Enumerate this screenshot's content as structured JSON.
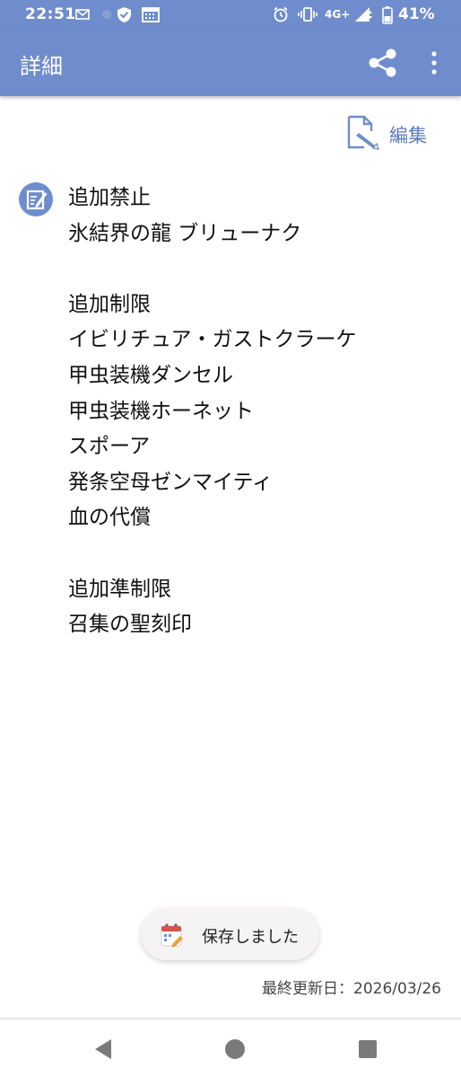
{
  "status_bar": {
    "time": "22:51",
    "network": "4G+",
    "battery": "41%",
    "icons": [
      "mail-icon",
      "vpn-shield-icon",
      "calendar-icon",
      "alarm-icon",
      "vibrate-icon",
      "signal-icon",
      "battery-icon"
    ]
  },
  "app_bar": {
    "title": "詳細",
    "icons": [
      "share-icon",
      "more-vert-icon"
    ],
    "color": "#6f8ccc"
  },
  "edit": {
    "label": "編集",
    "icon": "edit-document-icon",
    "color": "#5b79be"
  },
  "note": {
    "icon": "note-edit-icon",
    "lines": [
      "追加禁止",
      "氷結界の龍 ブリューナク",
      "",
      "追加制限",
      "イビリチュア・ガストクラーケ",
      "甲虫装機ダンセル",
      "甲虫装機ホーネット",
      "スポーア",
      "発条空母ゼンマイティ",
      "血の代償",
      "",
      "追加準制限",
      "召集の聖刻印"
    ]
  },
  "toast": {
    "text": "保存しました",
    "icon": "app-calendar-icon"
  },
  "last_updated": "最終更新日：2026/03/26",
  "nav": {
    "icons": [
      "back-icon",
      "home-icon",
      "recents-icon"
    ]
  }
}
